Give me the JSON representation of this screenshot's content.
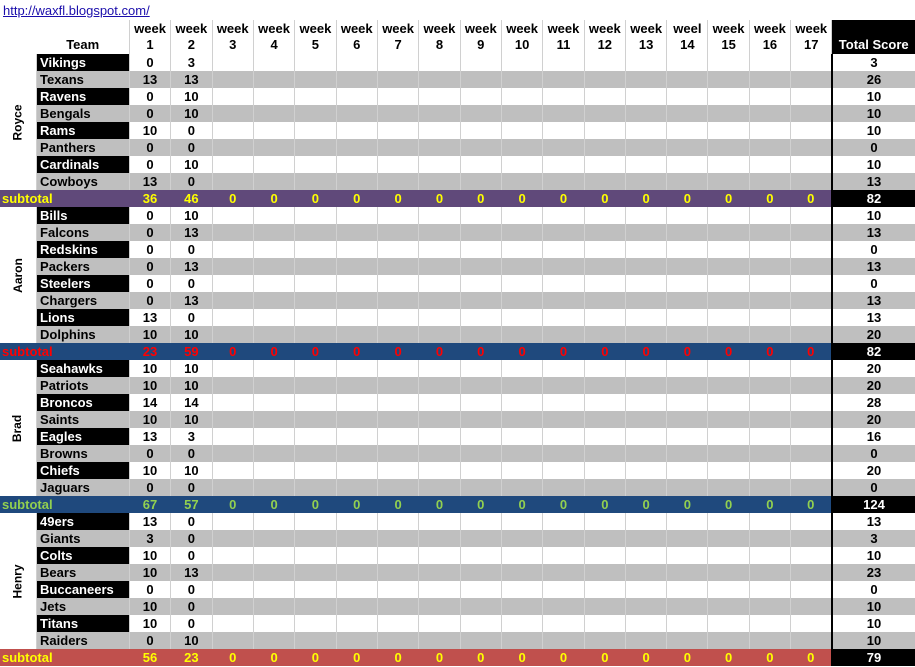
{
  "url": "http://waxfl.blogspot.com/",
  "header": {
    "team": "Team",
    "weeks": [
      {
        "top": "week",
        "num": "1"
      },
      {
        "top": "week",
        "num": "2"
      },
      {
        "top": "week",
        "num": "3"
      },
      {
        "top": "week",
        "num": "4"
      },
      {
        "top": "week",
        "num": "5"
      },
      {
        "top": "week",
        "num": "6"
      },
      {
        "top": "week",
        "num": "7"
      },
      {
        "top": "week",
        "num": "8"
      },
      {
        "top": "week",
        "num": "9"
      },
      {
        "top": "week",
        "num": "10"
      },
      {
        "top": "week",
        "num": "11"
      },
      {
        "top": "week",
        "num": "12"
      },
      {
        "top": "week",
        "num": "13"
      },
      {
        "top": "weel",
        "num": "14"
      },
      {
        "top": "week",
        "num": "15"
      },
      {
        "top": "week",
        "num": "16"
      },
      {
        "top": "week",
        "num": "17"
      }
    ],
    "total": "Total Score"
  },
  "groups": [
    {
      "player": "Royce",
      "teams": [
        {
          "name": "Vikings",
          "w1": "0",
          "w2": "3",
          "total": "3"
        },
        {
          "name": "Texans",
          "w1": "13",
          "w2": "13",
          "total": "26"
        },
        {
          "name": "Ravens",
          "w1": "0",
          "w2": "10",
          "total": "10"
        },
        {
          "name": "Bengals",
          "w1": "0",
          "w2": "10",
          "total": "10"
        },
        {
          "name": "Rams",
          "w1": "10",
          "w2": "0",
          "total": "10"
        },
        {
          "name": "Panthers",
          "w1": "0",
          "w2": "0",
          "total": "0"
        },
        {
          "name": "Cardinals",
          "w1": "0",
          "w2": "10",
          "total": "10"
        },
        {
          "name": "Cowboys",
          "w1": "13",
          "w2": "0",
          "total": "13"
        }
      ],
      "subtotal": {
        "label": "subtotal",
        "weeks": [
          "36",
          "46",
          "0",
          "0",
          "0",
          "0",
          "0",
          "0",
          "0",
          "0",
          "0",
          "0",
          "0",
          "0",
          "0",
          "0",
          "0"
        ],
        "total": "82"
      },
      "colors": {
        "bg": "#60497a",
        "fg": "#ffff00"
      }
    },
    {
      "player": "Aaron",
      "teams": [
        {
          "name": "Bills",
          "w1": "0",
          "w2": "10",
          "total": "10"
        },
        {
          "name": "Falcons",
          "w1": "0",
          "w2": "13",
          "total": "13"
        },
        {
          "name": "Redskins",
          "w1": "0",
          "w2": "0",
          "total": "0"
        },
        {
          "name": "Packers",
          "w1": "0",
          "w2": "13",
          "total": "13"
        },
        {
          "name": "Steelers",
          "w1": "0",
          "w2": "0",
          "total": "0"
        },
        {
          "name": "Chargers",
          "w1": "0",
          "w2": "13",
          "total": "13"
        },
        {
          "name": "Lions",
          "w1": "13",
          "w2": "0",
          "total": "13"
        },
        {
          "name": "Dolphins",
          "w1": "10",
          "w2": "10",
          "total": "20"
        }
      ],
      "subtotal": {
        "label": "subtotal",
        "weeks": [
          "23",
          "59",
          "0",
          "0",
          "0",
          "0",
          "0",
          "0",
          "0",
          "0",
          "0",
          "0",
          "0",
          "0",
          "0",
          "0",
          "0"
        ],
        "total": "82"
      },
      "colors": {
        "bg": "#1f497d",
        "fg": "#ff0000"
      }
    },
    {
      "player": "Brad",
      "teams": [
        {
          "name": "Seahawks",
          "w1": "10",
          "w2": "10",
          "total": "20"
        },
        {
          "name": "Patriots",
          "w1": "10",
          "w2": "10",
          "total": "20"
        },
        {
          "name": "Broncos",
          "w1": "14",
          "w2": "14",
          "total": "28"
        },
        {
          "name": "Saints",
          "w1": "10",
          "w2": "10",
          "total": "20"
        },
        {
          "name": "Eagles",
          "w1": "13",
          "w2": "3",
          "total": "16"
        },
        {
          "name": "Browns",
          "w1": "0",
          "w2": "0",
          "total": "0"
        },
        {
          "name": "Chiefs",
          "w1": "10",
          "w2": "10",
          "total": "20"
        },
        {
          "name": "Jaguars",
          "w1": "0",
          "w2": "0",
          "total": "0"
        }
      ],
      "subtotal": {
        "label": "subtotal",
        "weeks": [
          "67",
          "57",
          "0",
          "0",
          "0",
          "0",
          "0",
          "0",
          "0",
          "0",
          "0",
          "0",
          "0",
          "0",
          "0",
          "0",
          "0"
        ],
        "total": "124"
      },
      "colors": {
        "bg": "#1f497d",
        "fg": "#92d050"
      }
    },
    {
      "player": "Henry",
      "teams": [
        {
          "name": "49ers",
          "w1": "13",
          "w2": "0",
          "total": "13"
        },
        {
          "name": "Giants",
          "w1": "3",
          "w2": "0",
          "total": "3"
        },
        {
          "name": "Colts",
          "w1": "10",
          "w2": "0",
          "total": "10"
        },
        {
          "name": "Bears",
          "w1": "10",
          "w2": "13",
          "total": "23"
        },
        {
          "name": "Buccaneers",
          "w1": "0",
          "w2": "0",
          "total": "0"
        },
        {
          "name": "Jets",
          "w1": "10",
          "w2": "0",
          "total": "10"
        },
        {
          "name": "Titans",
          "w1": "10",
          "w2": "0",
          "total": "10"
        },
        {
          "name": "Raiders",
          "w1": "0",
          "w2": "10",
          "total": "10"
        }
      ],
      "subtotal": {
        "label": "subtotal",
        "weeks": [
          "56",
          "23",
          "0",
          "0",
          "0",
          "0",
          "0",
          "0",
          "0",
          "0",
          "0",
          "0",
          "0",
          "0",
          "0",
          "0",
          "0"
        ],
        "total": "79"
      },
      "colors": {
        "bg": "#c0504d",
        "fg": "#ffff00"
      }
    }
  ]
}
